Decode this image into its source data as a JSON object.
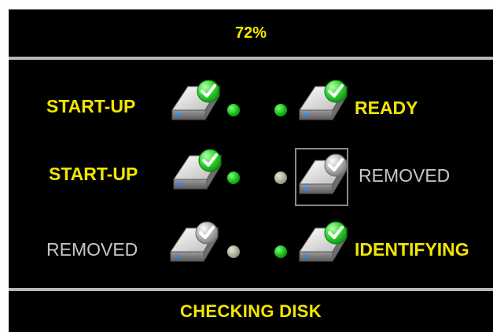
{
  "progress": {
    "text": "72%",
    "percent": 72
  },
  "status": {
    "text": "CHECKING DISK"
  },
  "colors": {
    "active": "#f2e600",
    "removed": "#c8c8c8",
    "led_on": "#13b513",
    "led_off": "#a6a694",
    "check_on": "#1fd11f",
    "check_off": "#9a9a9a"
  },
  "disks": [
    {
      "label": "START-UP",
      "state": "active",
      "icon": "hard-drive-check-icon",
      "led": "green"
    },
    {
      "label": "READY",
      "state": "active",
      "icon": "hard-drive-check-icon",
      "led": "green"
    },
    {
      "label": "START-UP",
      "state": "active",
      "icon": "hard-drive-check-icon",
      "led": "green"
    },
    {
      "label": "REMOVED",
      "state": "removed",
      "icon": "hard-drive-check-gray-icon",
      "led": "gray",
      "selected": true
    },
    {
      "label": "REMOVED",
      "state": "removed",
      "icon": "hard-drive-check-gray-icon",
      "led": "gray"
    },
    {
      "label": "IDENTIFYING",
      "state": "active",
      "icon": "hard-drive-check-icon",
      "led": "green"
    }
  ]
}
